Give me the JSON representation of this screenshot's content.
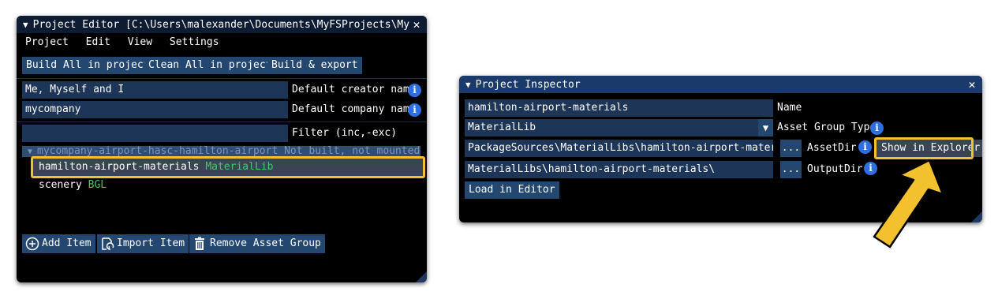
{
  "project_editor": {
    "title": "Project Editor [C:\\Users\\malexander\\Documents\\MyFSProjects\\MyTestAirport",
    "menu": [
      "Project",
      "Edit",
      "View",
      "Settings"
    ],
    "toolbar": {
      "build_all": "Build All in project",
      "clean_all": "Clean All in project",
      "build_export": "Build & export"
    },
    "creator_name": {
      "value": "Me, Myself and I",
      "label": "Default creator name"
    },
    "company_name": {
      "value": "mycompany",
      "label": "Default company name"
    },
    "filter": {
      "value": "",
      "label": "Filter (inc,-exc)"
    },
    "tree_header": "mycompany-airport-hasc-hamilton-airport  Not built, not mounted",
    "items": [
      {
        "name": "hamilton-airport-materials",
        "type": "MaterialLib"
      },
      {
        "name": "scenery",
        "type": "BGL"
      }
    ],
    "buttons": {
      "add_item": "Add Item",
      "import_item": "Import Item",
      "remove_group": "Remove Asset Group"
    }
  },
  "project_inspector": {
    "title": "Project Inspector",
    "name": {
      "value": "hamilton-airport-materials",
      "label": "Name"
    },
    "asset_group_type": {
      "value": "MaterialLib",
      "label": "Asset Group Type"
    },
    "asset_dir": {
      "value": "PackageSources\\MaterialLibs\\hamilton-airport-materials\\",
      "label": "AssetDir"
    },
    "output_dir": {
      "value": "MaterialLibs\\hamilton-airport-materials\\",
      "label": "OutputDir"
    },
    "browse": "...",
    "show_in_explorer": "Show in Explorer",
    "load_in_editor": "Load in Editor"
  },
  "colors": {
    "highlight": "#f3c12d",
    "accent": "#2d6fe0",
    "field": "#1d3557"
  }
}
